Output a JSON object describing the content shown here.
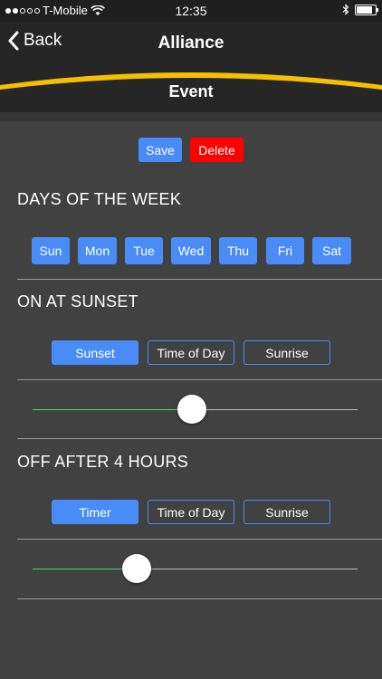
{
  "status": {
    "carrier": "T-Mobile",
    "time": "12:35"
  },
  "nav": {
    "back_label": "Back",
    "title": "Alliance",
    "subtitle": "Event"
  },
  "actions": {
    "save_label": "Save",
    "delete_label": "Delete"
  },
  "days": {
    "title": "DAYS OF THE WEEK",
    "items": [
      "Sun",
      "Mon",
      "Tue",
      "Wed",
      "Thu",
      "Fri",
      "Sat"
    ]
  },
  "on": {
    "title": "ON AT SUNSET",
    "options": [
      "Sunset",
      "Time of Day",
      "Sunrise"
    ],
    "selected": "Sunset",
    "slider_value": 0.49
  },
  "off": {
    "title": "OFF AFTER 4 HOURS",
    "options": [
      "Timer",
      "Time of Day",
      "Sunrise"
    ],
    "selected": "Timer",
    "slider_value": 0.32
  },
  "colors": {
    "accent": "#4a8cf7",
    "delete": "#ff0000",
    "nav_arc": "#f5c000",
    "slider_fill": "#4cd964",
    "slider_track": "#bdbdbd"
  }
}
